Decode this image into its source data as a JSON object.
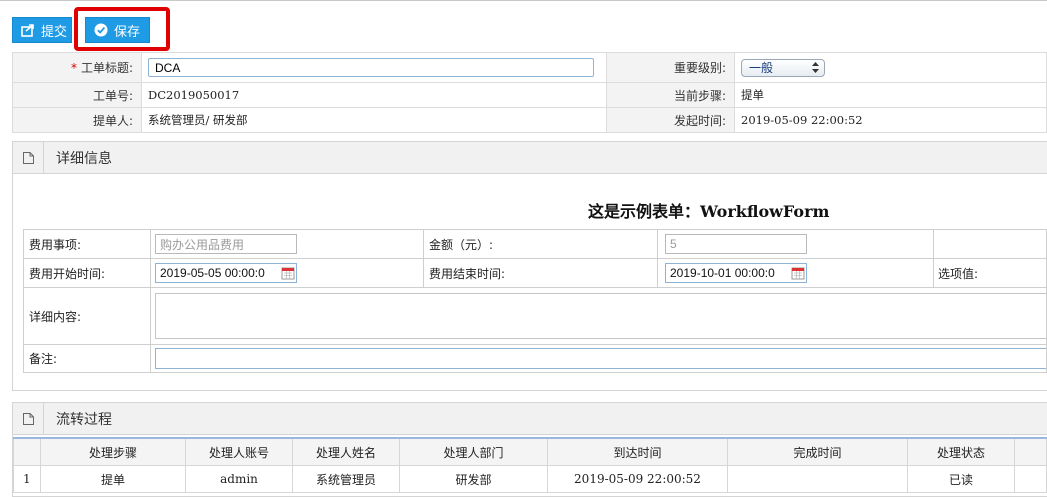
{
  "toolbar": {
    "submit_label": "提交",
    "save_label": "保存"
  },
  "header": {
    "title_label": "工单标题:",
    "title_value": "DCA",
    "level_label": "重要级别:",
    "level_value": "一般",
    "no_label": "工单号:",
    "no_value": "DC2019050017",
    "step_label": "当前步骤:",
    "step_value": "提单",
    "submitter_label": "提单人:",
    "submitter_value": "系统管理员/ 研发部",
    "start_label": "发起时间:",
    "start_value": "2019-05-09 22:00:52"
  },
  "detail": {
    "panel_title": "详细信息",
    "form_title": "这是示例表单：WorkflowForm",
    "item_label": "费用事项:",
    "item_placeholder": "购办公用品费用",
    "amount_label": "金额（元）:",
    "amount_value": "5",
    "begin_label": "费用开始时间:",
    "begin_value": "2019-05-05 00:00:0",
    "end_label": "费用结束时间:",
    "end_value": "2019-10-01 00:00:0",
    "option_label": "选项值:",
    "content_label": "详细内容:",
    "remark_label": "备注:"
  },
  "flow": {
    "panel_title": "流转过程",
    "columns": [
      "处理步骤",
      "处理人账号",
      "处理人姓名",
      "处理人部门",
      "到达时间",
      "完成时间",
      "处理状态"
    ],
    "rows": [
      {
        "no": "1",
        "step": "提单",
        "account": "admin",
        "name": "系统管理员",
        "dept": "研发部",
        "arrive": "2019-05-09 22:00:52",
        "finish": "",
        "status": "已读"
      }
    ]
  }
}
